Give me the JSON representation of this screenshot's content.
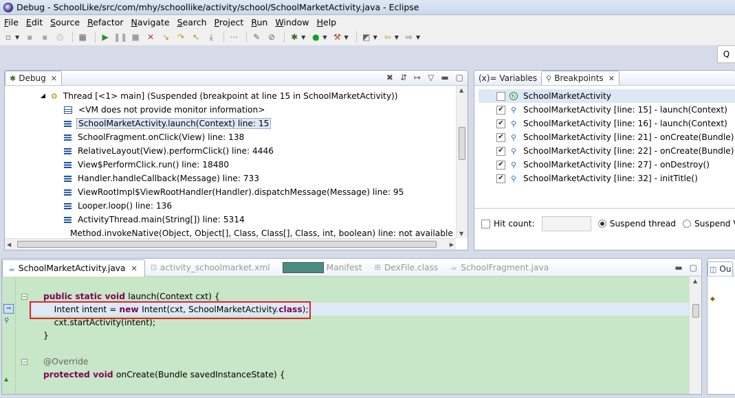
{
  "window": {
    "title": "Debug - SchoolLike/src/com/mhy/schoollike/activity/school/SchoolMarketActivity.java - Eclipse"
  },
  "menu": [
    "File",
    "Edit",
    "Source",
    "Refactor",
    "Navigate",
    "Search",
    "Project",
    "Run",
    "Window",
    "Help"
  ],
  "toolbar": {
    "icons": [
      "new-icon",
      "save-icon",
      "save-all-icon",
      "print-icon",
      "open-type-icon",
      "resume-icon",
      "suspend-icon",
      "terminate-icon",
      "disconnect-icon",
      "step-into-icon",
      "step-over-icon",
      "step-return-icon",
      "drop-to-frame-icon",
      "use-step-filters-icon",
      "toggle-breakpoint-icon",
      "skip-breakpoints-icon",
      "debug-icon",
      "run-icon",
      "external-tools-icon",
      "open-perspective-icon",
      "back-icon",
      "forward-icon"
    ],
    "quick_access_glyph": "Q"
  },
  "debug_view": {
    "tab_label": "Debug",
    "thread": "Thread [<1> main] (Suspended (breakpoint at line 15 in SchoolMarketActivity))",
    "frames": [
      {
        "label": "<VM does not provide monitor information>",
        "kind": "info"
      },
      {
        "label": "SchoolMarketActivity.launch(Context) line: 15",
        "kind": "frame",
        "selected": true
      },
      {
        "label": "SchoolFragment.onClick(View) line: 138",
        "kind": "frame"
      },
      {
        "label": "RelativeLayout(View).performClick() line: 4446",
        "kind": "frame"
      },
      {
        "label": "View$PerformClick.run() line: 18480",
        "kind": "frame"
      },
      {
        "label": "Handler.handleCallback(Message) line: 733",
        "kind": "frame"
      },
      {
        "label": "ViewRootImpl$ViewRootHandler(Handler).dispatchMessage(Message) line: 95",
        "kind": "frame"
      },
      {
        "label": "Looper.loop() line: 136",
        "kind": "frame"
      },
      {
        "label": "ActivityThread.main(String[]) line: 5314",
        "kind": "frame"
      },
      {
        "label": "Method.invokeNative(Object, Object[], Class, Class[], Class, int, boolean) line: not available [na",
        "kind": "frame"
      }
    ]
  },
  "breakpoints_view": {
    "tabs": [
      "(x)= Variables",
      "Breakpoints"
    ],
    "items": [
      {
        "label": "SchoolMarketActivity",
        "checked": false,
        "type": "class"
      },
      {
        "label": "SchoolMarketActivity [line: 15] - launch(Context)",
        "checked": true,
        "type": "line"
      },
      {
        "label": "SchoolMarketActivity [line: 16] - launch(Context)",
        "checked": true,
        "type": "line"
      },
      {
        "label": "SchoolMarketActivity [line: 21] - onCreate(Bundle)",
        "checked": true,
        "type": "line"
      },
      {
        "label": "SchoolMarketActivity [line: 22] - onCreate(Bundle)",
        "checked": true,
        "type": "line"
      },
      {
        "label": "SchoolMarketActivity [line: 27] - onDestroy()",
        "checked": true,
        "type": "line"
      },
      {
        "label": "SchoolMarketActivity [line: 32] - initTitle()",
        "checked": true,
        "type": "line"
      }
    ],
    "hit_count_label": "Hit count:",
    "hit_count_value": "",
    "suspend_thread_label": "Suspend thread",
    "suspend_vm_label": "Suspend VM"
  },
  "editor": {
    "tabs": [
      {
        "label": "SchoolMarketActivity.java",
        "active": true
      },
      {
        "label": "activity_schoolmarket.xml"
      },
      {
        "label": "Manifest",
        "redacted_prefix": true
      },
      {
        "label": "DexFile.class"
      },
      {
        "label": "SchoolFragment.java"
      }
    ],
    "lines": [
      {
        "text": ""
      },
      {
        "parts": [
          {
            "t": "public static void ",
            "c": "kw"
          },
          {
            "t": "launch(Context cxt) {",
            "c": ""
          }
        ]
      },
      {
        "parts": [
          {
            "t": "    Intent intent = ",
            "c": ""
          },
          {
            "t": "new ",
            "c": "kw"
          },
          {
            "t": "Intent(cxt, SchoolMarketActivity.",
            "c": ""
          },
          {
            "t": "class",
            "c": "kw"
          },
          {
            "t": ");",
            "c": ""
          }
        ],
        "current": true
      },
      {
        "parts": [
          {
            "t": "    cxt.startActivity(intent);",
            "c": ""
          }
        ]
      },
      {
        "parts": [
          {
            "t": "}",
            "c": ""
          }
        ]
      },
      {
        "text": ""
      },
      {
        "parts": [
          {
            "t": "@Override",
            "c": "ann"
          }
        ]
      },
      {
        "parts": [
          {
            "t": "protected void ",
            "c": "kw"
          },
          {
            "t": "onCreate(Bundle savedInstanceState) {",
            "c": ""
          }
        ]
      }
    ]
  },
  "outline": {
    "tab_label": "Ou"
  },
  "colors": {
    "keyword": "#7f0055",
    "editor_bg": "#c8e6c8",
    "current_line": "#dde9f6",
    "highlight_box": "#e0202a",
    "selection": "#dde8f7"
  }
}
